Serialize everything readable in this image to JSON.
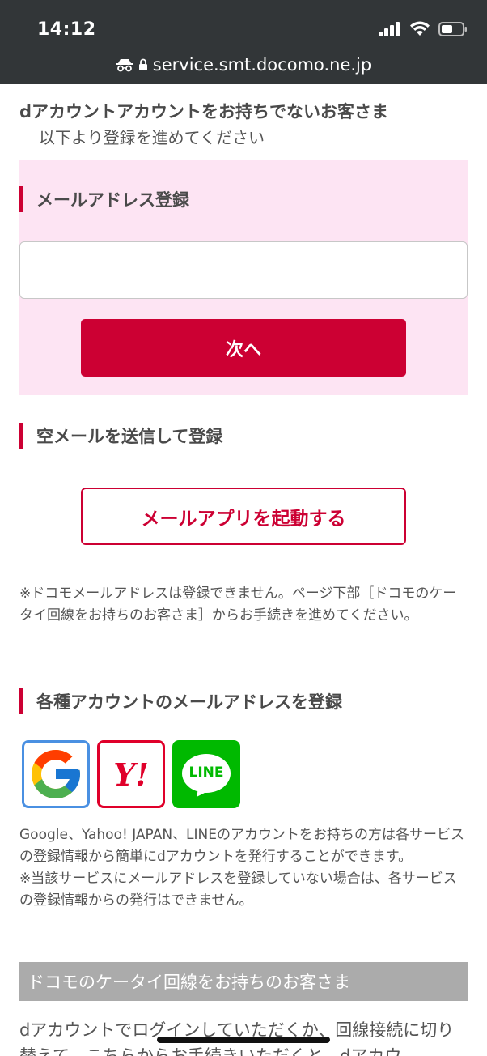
{
  "status_bar": {
    "time": "14:12",
    "url": "service.smt.docomo.ne.jp"
  },
  "intro": {
    "title": "dアカウントアカウントをお持ちでないお客さま",
    "subtitle": "以下より登録を進めてください"
  },
  "email_section": {
    "heading": "メールアドレス登録",
    "input_value": "",
    "input_placeholder": "",
    "next_label": "次へ"
  },
  "empty_mail_section": {
    "heading": "空メールを送信して登録",
    "button_label": "メールアプリを起動する"
  },
  "note": "※ドコモメールアドレスは登録できません。ページ下部［ドコモのケータイ回線をお持ちのお客さま］からお手続きを進めてください。",
  "accounts_section": {
    "heading": "各種アカウントのメールアドレスを登録",
    "icons": [
      "google-icon",
      "yahoo-japan-icon",
      "line-icon"
    ],
    "yahoo_logo_text": "Y!",
    "line_logo_text": "LINE",
    "description_1": "Google、Yahoo! JAPAN、LINEのアカウントをお持ちの方は各サービスの登録情報から簡単にdアカウントを発行することができます。",
    "description_2": "※当該サービスにメールアドレスを登録していない場合は、各サービスの登録情報からの発行はできません。"
  },
  "docomo_section": {
    "band_label": "ドコモのケータイ回線をお持ちのお客さま",
    "text": "dアカウントでログインしていただくか、回線接続に切り替えて、こちらからお手続きいただくと、dアカウ"
  },
  "colors": {
    "accent": "#cc0033",
    "pink_bg": "#fde4f3",
    "status_bg": "#323638",
    "gray_band": "#ababab"
  }
}
